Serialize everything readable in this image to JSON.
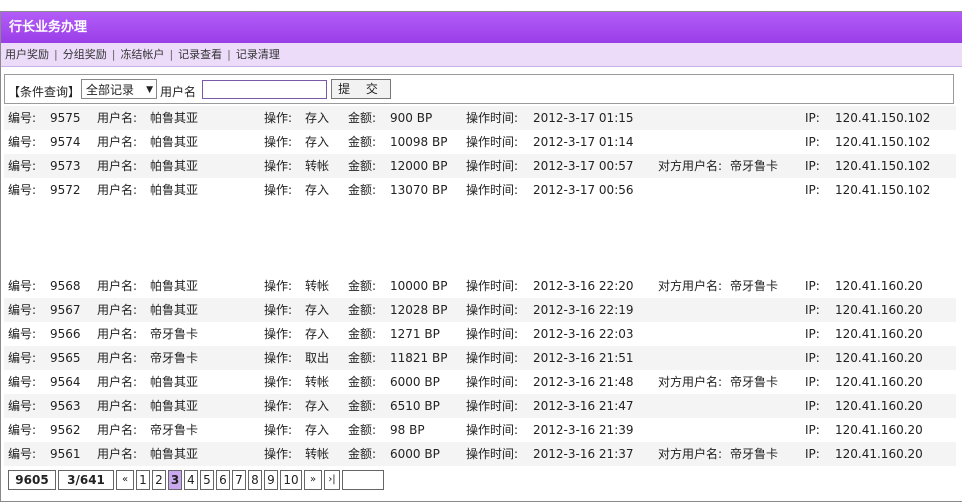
{
  "title": "行长业务办理",
  "menu": [
    "用户奖励",
    "分组奖励",
    "冻结帐户",
    "记录查看",
    "记录清理"
  ],
  "search": {
    "label": "【条件查询】",
    "select_value": "全部记录",
    "user_label": "用户名",
    "input_value": "",
    "submit_label": "提 交"
  },
  "labels": {
    "id": "编号:",
    "user": "用户名:",
    "op": "操作:",
    "amount": "金额:",
    "time": "操作时间:",
    "target": "对方用户名:",
    "ip": "IP:"
  },
  "records_top": [
    {
      "id": "9575",
      "user": "帕鲁其亚",
      "op": "存入",
      "amount": "900 BP",
      "time": "2012-3-17 01:15",
      "target": "",
      "ip": "120.41.150.102"
    },
    {
      "id": "9574",
      "user": "帕鲁其亚",
      "op": "存入",
      "amount": "10098 BP",
      "time": "2012-3-17 01:14",
      "target": "",
      "ip": "120.41.150.102"
    },
    {
      "id": "9573",
      "user": "帕鲁其亚",
      "op": "转帐",
      "amount": "12000 BP",
      "time": "2012-3-17 00:57",
      "target": "帝牙鲁卡",
      "ip": "120.41.150.102"
    },
    {
      "id": "9572",
      "user": "帕鲁其亚",
      "op": "存入",
      "amount": "13070 BP",
      "time": "2012-3-17 00:56",
      "target": "",
      "ip": "120.41.150.102"
    }
  ],
  "records_bottom": [
    {
      "id": "9568",
      "user": "帕鲁其亚",
      "op": "转帐",
      "amount": "10000 BP",
      "time": "2012-3-16 22:20",
      "target": "帝牙鲁卡",
      "ip": "120.41.160.20"
    },
    {
      "id": "9567",
      "user": "帕鲁其亚",
      "op": "存入",
      "amount": "12028 BP",
      "time": "2012-3-16 22:19",
      "target": "",
      "ip": "120.41.160.20"
    },
    {
      "id": "9566",
      "user": "帝牙鲁卡",
      "op": "存入",
      "amount": "1271 BP",
      "time": "2012-3-16 22:03",
      "target": "",
      "ip": "120.41.160.20"
    },
    {
      "id": "9565",
      "user": "帝牙鲁卡",
      "op": "取出",
      "amount": "11821 BP",
      "time": "2012-3-16 21:51",
      "target": "",
      "ip": "120.41.160.20"
    },
    {
      "id": "9564",
      "user": "帕鲁其亚",
      "op": "转帐",
      "amount": "6000 BP",
      "time": "2012-3-16 21:48",
      "target": "帝牙鲁卡",
      "ip": "120.41.160.20"
    },
    {
      "id": "9563",
      "user": "帕鲁其亚",
      "op": "存入",
      "amount": "6510 BP",
      "time": "2012-3-16 21:47",
      "target": "",
      "ip": "120.41.160.20"
    },
    {
      "id": "9562",
      "user": "帝牙鲁卡",
      "op": "存入",
      "amount": "98 BP",
      "time": "2012-3-16 21:39",
      "target": "",
      "ip": "120.41.160.20"
    },
    {
      "id": "9561",
      "user": "帕鲁其亚",
      "op": "转帐",
      "amount": "6000 BP",
      "time": "2012-3-16 21:37",
      "target": "帝牙鲁卡",
      "ip": "120.41.160.20"
    }
  ],
  "pager": {
    "total": "9605",
    "page_info": "3/641",
    "first": "«",
    "pages": [
      "1",
      "2",
      "3",
      "4",
      "5",
      "6",
      "7",
      "8",
      "9",
      "10"
    ],
    "current": "3",
    "next": "»",
    "last": "›|",
    "jump_value": ""
  },
  "colors": {
    "title_bg": "#a94ef5",
    "menu_bg": "#ecdcfa",
    "current_page": "#c9a8f0"
  }
}
